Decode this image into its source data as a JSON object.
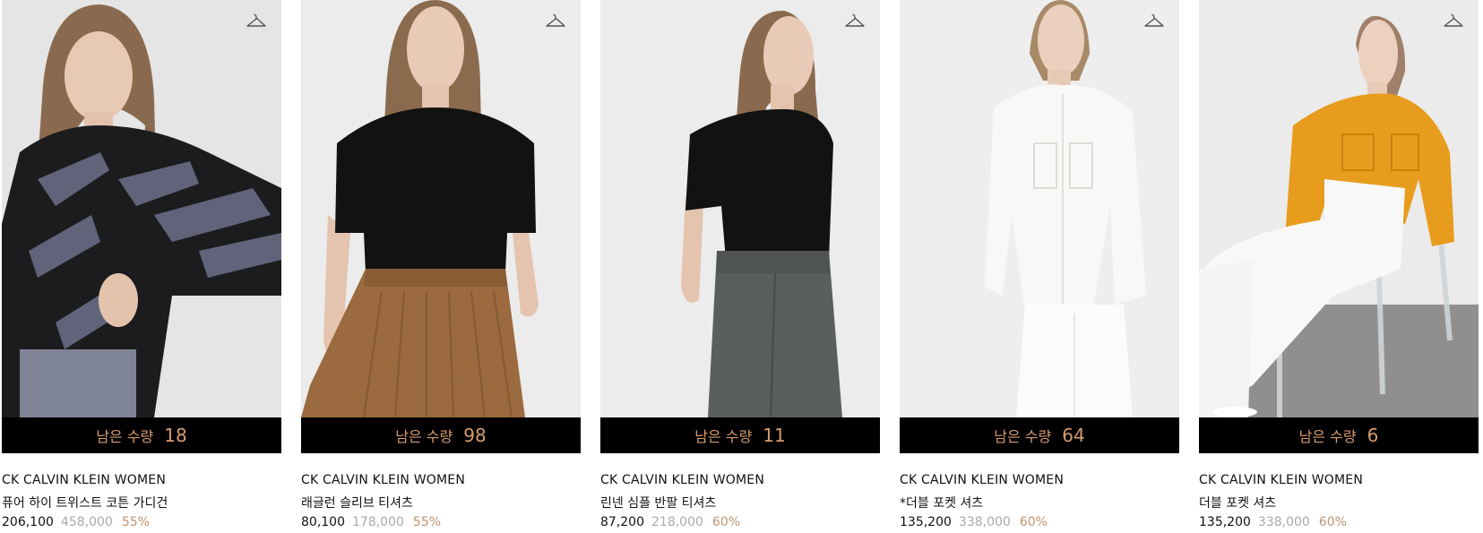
{
  "products": [
    {
      "stock_label": "남은 수량",
      "stock_count": "18",
      "brand": "CK CALVIN KLEIN WOMEN",
      "name": "퓨어 하이 트위스트 코튼 가디건",
      "sale_price": "206,100",
      "original_price": "458,000",
      "discount": "55%",
      "colors": {
        "bg": "#e9e9e9",
        "top": "#1a1a1c",
        "accent": "#5f6273",
        "bottom": "#808496"
      }
    },
    {
      "stock_label": "남은 수량",
      "stock_count": "98",
      "brand": "CK CALVIN KLEIN WOMEN",
      "name": "래글런 슬리브 티셔츠",
      "sale_price": "80,100",
      "original_price": "178,000",
      "discount": "55%",
      "colors": {
        "bg": "#ededed",
        "top": "#111111",
        "accent": "#111111",
        "bottom": "#9a6a3e"
      }
    },
    {
      "stock_label": "남은 수량",
      "stock_count": "11",
      "brand": "CK CALVIN KLEIN WOMEN",
      "name": "린넨 심플 반팔 티셔츠",
      "sale_price": "87,200",
      "original_price": "218,000",
      "discount": "60%",
      "colors": {
        "bg": "#ececec",
        "top": "#121212",
        "accent": "#121212",
        "bottom": "#5b5f5e"
      }
    },
    {
      "stock_label": "남은 수량",
      "stock_count": "64",
      "brand": "CK CALVIN KLEIN WOMEN",
      "name": "*더블 포켓 셔츠",
      "sale_price": "135,200",
      "original_price": "338,000",
      "discount": "60%",
      "colors": {
        "bg": "#ededed",
        "top": "#f7f7f5",
        "accent": "#e2e2de",
        "bottom": "#fafafa"
      }
    },
    {
      "stock_label": "남은 수량",
      "stock_count": "6",
      "brand": "CK CALVIN KLEIN WOMEN",
      "name": "더블 포켓 셔츠",
      "sale_price": "135,200",
      "original_price": "338,000",
      "discount": "60%",
      "colors": {
        "bg": "#e9e9e9",
        "top": "#e69a1a",
        "accent": "#d9880e",
        "bottom": "#f7f7f7"
      }
    }
  ]
}
